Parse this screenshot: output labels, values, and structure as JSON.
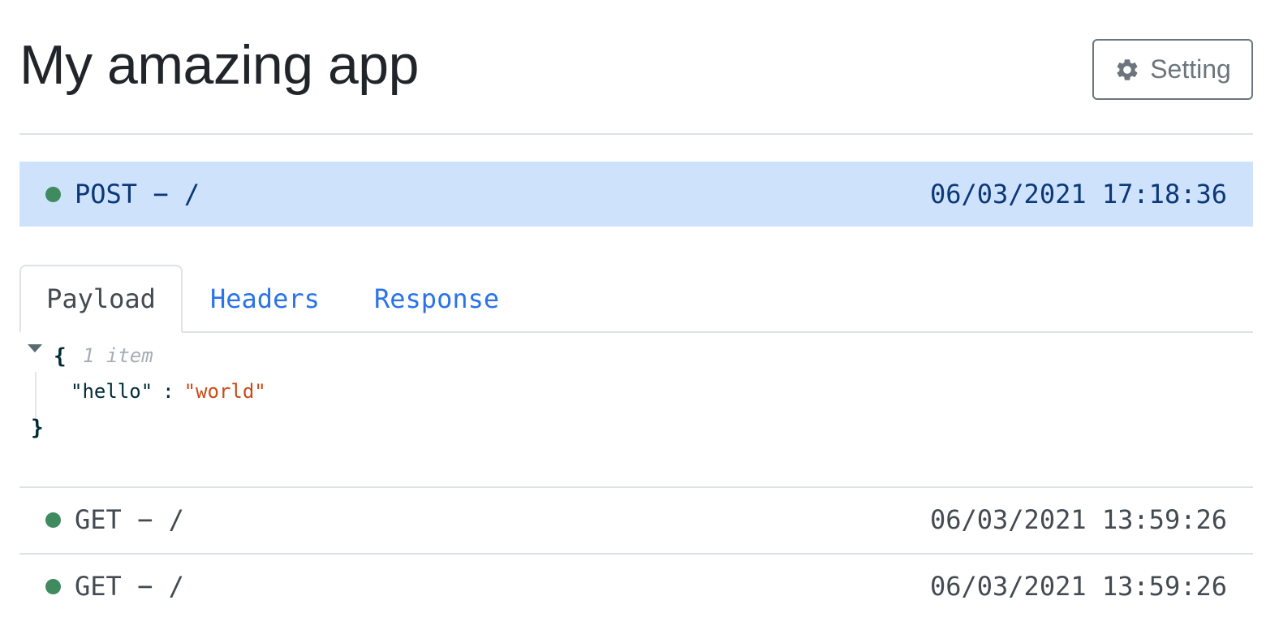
{
  "app": {
    "title": "My amazing app",
    "setting_label": "Setting",
    "setting_icon": "gear-icon"
  },
  "active_request": {
    "method": "POST",
    "separator": "−",
    "path": "/",
    "timestamp": "06/03/2021 17:18:36",
    "status_color": "#3f8a5f"
  },
  "tabs": [
    {
      "label": "Payload",
      "active": true
    },
    {
      "label": "Headers",
      "active": false
    },
    {
      "label": "Response",
      "active": false
    }
  ],
  "payload": {
    "open_brace": "{",
    "item_count": "1 item",
    "entries": [
      {
        "key": "\"hello\"",
        "colon": ":",
        "value": "\"world\""
      }
    ],
    "close_brace": "}"
  },
  "requests": [
    {
      "method": "GET",
      "separator": "−",
      "path": "/",
      "timestamp": "06/03/2021 13:59:26",
      "status_color": "#3f8a5f"
    },
    {
      "method": "GET",
      "separator": "−",
      "path": "/",
      "timestamp": "06/03/2021 13:59:26",
      "status_color": "#3f8a5f"
    }
  ],
  "colors": {
    "active_row_bg": "#cfe2fb",
    "active_row_text": "#0a3878",
    "link": "#2a73e8",
    "json_string": "#cb4b16"
  }
}
